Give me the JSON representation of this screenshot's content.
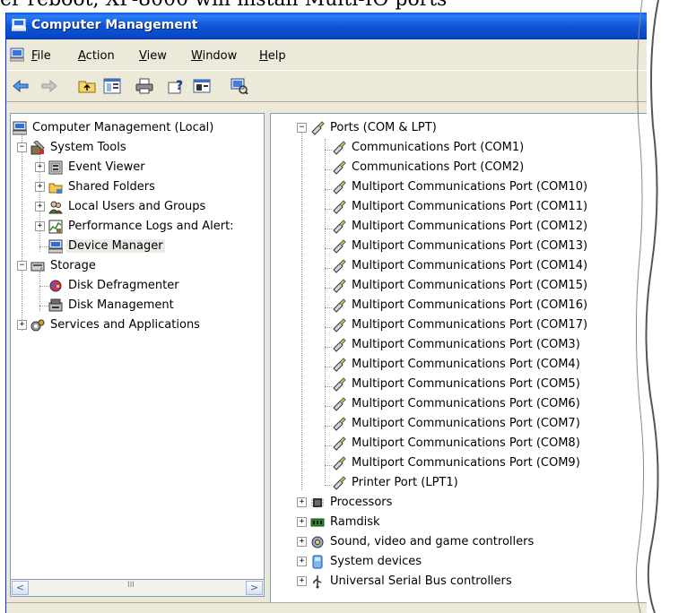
{
  "caption": "er reboot, XP-8000 will install Multi-IO ports",
  "window": {
    "title": "Computer Management"
  },
  "menu": [
    {
      "pre": "",
      "key": "F",
      "post": "ile"
    },
    {
      "pre": "",
      "key": "A",
      "post": "ction"
    },
    {
      "pre": "",
      "key": "V",
      "post": "iew"
    },
    {
      "pre": "",
      "key": "W",
      "post": "indow"
    },
    {
      "pre": "",
      "key": "H",
      "post": "elp"
    }
  ],
  "tree": [
    {
      "label": "Computer Management (Local)",
      "icon": "computer-icon"
    },
    {
      "label": "System Tools",
      "icon": "tools-icon"
    },
    {
      "label": "Event Viewer",
      "icon": "event-viewer-icon"
    },
    {
      "label": "Shared Folders",
      "icon": "folder-icon"
    },
    {
      "label": "Local Users and Groups",
      "icon": "users-icon"
    },
    {
      "label": "Performance Logs and Alert:",
      "icon": "performance-icon"
    },
    {
      "label": "Device Manager",
      "icon": "device-manager-icon"
    },
    {
      "label": "Storage",
      "icon": "storage-icon"
    },
    {
      "label": "Disk Defragmenter",
      "icon": "defrag-icon"
    },
    {
      "label": "Disk Management",
      "icon": "disk-icon"
    },
    {
      "label": "Services and Applications",
      "icon": "services-icon"
    }
  ],
  "devices": {
    "ports_label": "Ports (COM & LPT)",
    "ports": [
      "Communications Port (COM1)",
      "Communications Port (COM2)",
      "Multiport Communications Port (COM10)",
      "Multiport Communications Port (COM11)",
      "Multiport Communications Port (COM12)",
      "Multiport Communications Port (COM13)",
      "Multiport Communications Port (COM14)",
      "Multiport Communications Port (COM15)",
      "Multiport Communications Port (COM16)",
      "Multiport Communications Port (COM17)",
      "Multiport Communications Port (COM3)",
      "Multiport Communications Port (COM4)",
      "Multiport Communications Port (COM5)",
      "Multiport Communications Port (COM6)",
      "Multiport Communications Port (COM7)",
      "Multiport Communications Port (COM8)",
      "Multiport Communications Port (COM9)",
      "Printer Port (LPT1)"
    ],
    "categories": [
      {
        "label": "Processors",
        "icon": "processor-icon"
      },
      {
        "label": "Ramdisk",
        "icon": "ramdisk-icon"
      },
      {
        "label": "Sound, video and game controllers",
        "icon": "sound-icon"
      },
      {
        "label": "System devices",
        "icon": "system-device-icon"
      },
      {
        "label": "Universal Serial Bus controllers",
        "icon": "usb-icon"
      }
    ]
  },
  "scrollbar": {
    "left": "<",
    "right": ">",
    "grip": "III"
  }
}
